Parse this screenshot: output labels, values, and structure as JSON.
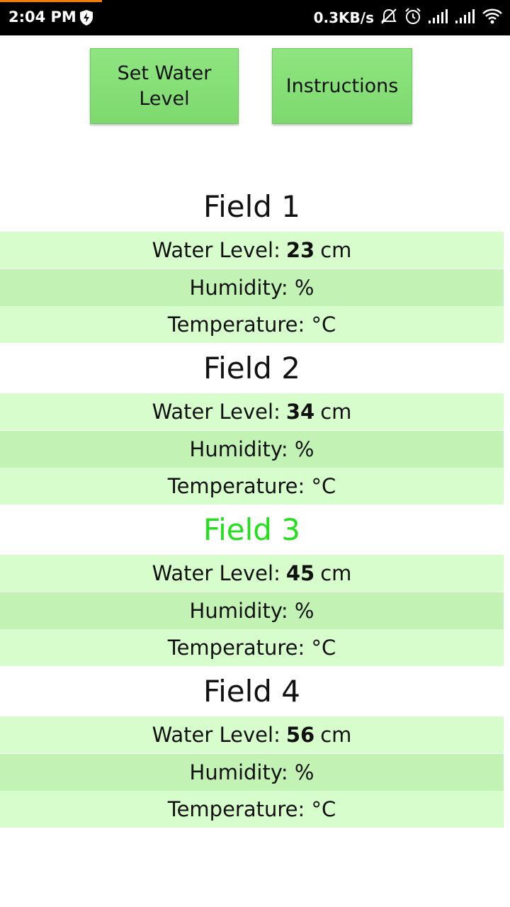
{
  "status_bar": {
    "time": "2:04 PM",
    "speed": "0.3KB/s",
    "icons": [
      "shield-bolt-icon",
      "alarm-muted-icon",
      "alarm-clock-icon",
      "signal-icon",
      "signal-icon",
      "wifi-icon"
    ],
    "accent_color": "#f57c00"
  },
  "buttons": {
    "set_water_level": "Set Water Level",
    "instructions": "Instructions",
    "color": "#86df77"
  },
  "labels": {
    "water_level": "Water Level:",
    "unit_cm": "cm",
    "humidity": "Humidity: %",
    "temperature": "Temperature: °C"
  },
  "fields": [
    {
      "title": "Field 1",
      "water_level": "23",
      "active": false
    },
    {
      "title": "Field 2",
      "water_level": "34",
      "active": false
    },
    {
      "title": "Field 3",
      "water_level": "45",
      "active": true
    },
    {
      "title": "Field 4",
      "water_level": "56",
      "active": false
    }
  ],
  "colors": {
    "active_title": "#22e11c",
    "row_light": "#d8fdcc",
    "row_dark": "#c3f3b4"
  }
}
